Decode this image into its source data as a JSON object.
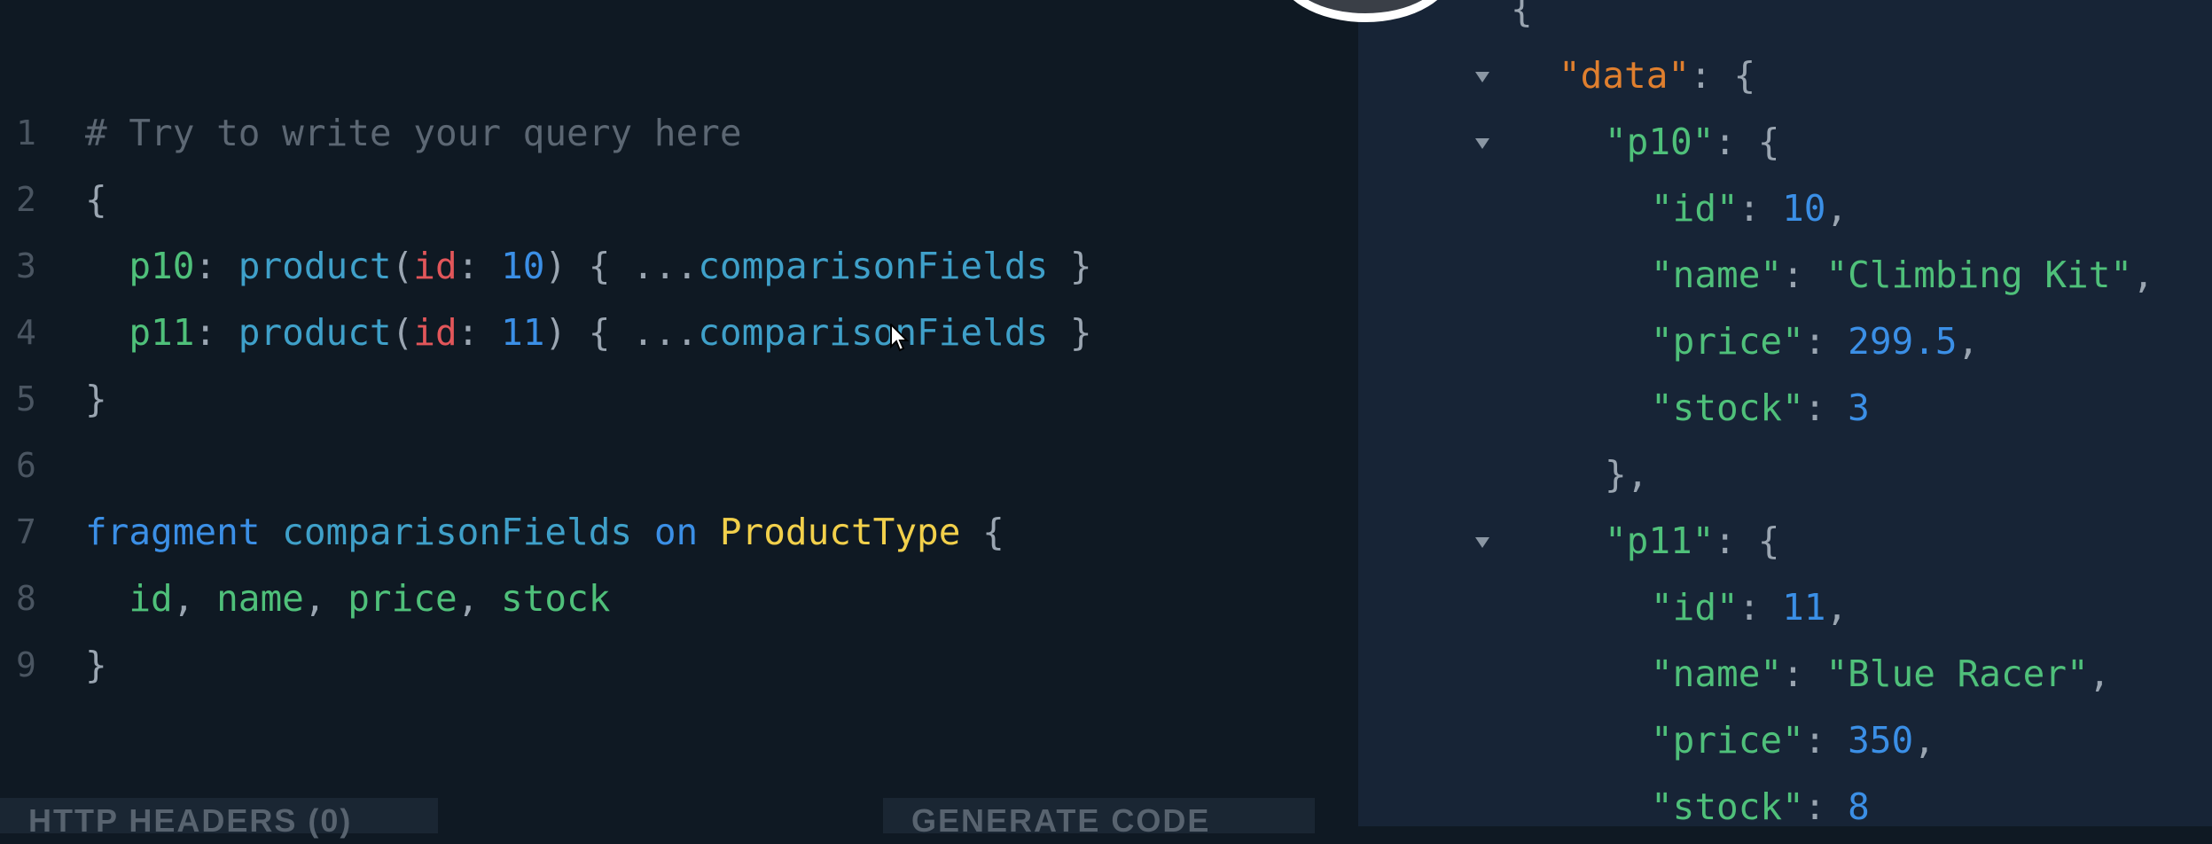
{
  "editor": {
    "lines": [
      {
        "n": "1",
        "tokens": [
          {
            "t": "# Try to write your query here",
            "c": "c-comment"
          }
        ]
      },
      {
        "n": "2",
        "tokens": [
          {
            "t": "{",
            "c": "c-punct"
          }
        ]
      },
      {
        "n": "3",
        "tokens": [
          {
            "t": "  p10",
            "c": "c-alias"
          },
          {
            "t": ": ",
            "c": "c-punct"
          },
          {
            "t": "product",
            "c": "c-func"
          },
          {
            "t": "(",
            "c": "c-punct"
          },
          {
            "t": "id",
            "c": "c-arg"
          },
          {
            "t": ": ",
            "c": "c-punct"
          },
          {
            "t": "10",
            "c": "c-num"
          },
          {
            "t": ") { ...",
            "c": "c-punct"
          },
          {
            "t": "comparisonFields",
            "c": "c-frag"
          },
          {
            "t": " }",
            "c": "c-punct"
          }
        ]
      },
      {
        "n": "4",
        "tokens": [
          {
            "t": "  p11",
            "c": "c-alias"
          },
          {
            "t": ": ",
            "c": "c-punct"
          },
          {
            "t": "product",
            "c": "c-func"
          },
          {
            "t": "(",
            "c": "c-punct"
          },
          {
            "t": "id",
            "c": "c-arg"
          },
          {
            "t": ": ",
            "c": "c-punct"
          },
          {
            "t": "11",
            "c": "c-num"
          },
          {
            "t": ") { ...",
            "c": "c-punct"
          },
          {
            "t": "comparisonFields",
            "c": "c-frag"
          },
          {
            "t": " }",
            "c": "c-punct"
          }
        ]
      },
      {
        "n": "5",
        "tokens": [
          {
            "t": "}",
            "c": "c-punct"
          }
        ]
      },
      {
        "n": "6",
        "tokens": []
      },
      {
        "n": "7",
        "tokens": [
          {
            "t": "fragment",
            "c": "c-kw"
          },
          {
            "t": " ",
            "c": "c-punct"
          },
          {
            "t": "comparisonFields",
            "c": "c-frag"
          },
          {
            "t": " ",
            "c": "c-punct"
          },
          {
            "t": "on",
            "c": "c-kw"
          },
          {
            "t": " ",
            "c": "c-punct"
          },
          {
            "t": "ProductType",
            "c": "c-type"
          },
          {
            "t": " {",
            "c": "c-punct"
          }
        ]
      },
      {
        "n": "8",
        "tokens": [
          {
            "t": "  id",
            "c": "c-field"
          },
          {
            "t": ", ",
            "c": "c-punct"
          },
          {
            "t": "name",
            "c": "c-field"
          },
          {
            "t": ", ",
            "c": "c-punct"
          },
          {
            "t": "price",
            "c": "c-field"
          },
          {
            "t": ", ",
            "c": "c-punct"
          },
          {
            "t": "stock",
            "c": "c-field"
          }
        ]
      },
      {
        "n": "9",
        "tokens": [
          {
            "t": "}",
            "c": "c-punct"
          }
        ]
      }
    ]
  },
  "bottom_bar": {
    "headers_label": "HTTP HEADERS (0)",
    "generate_label": "GENERATE CODE"
  },
  "results": {
    "lines": [
      {
        "arrow": false,
        "indent": 0,
        "tokens": [
          {
            "t": "{",
            "c": "r-punct"
          }
        ]
      },
      {
        "arrow": true,
        "indent": 1,
        "tokens": [
          {
            "t": "\"data\"",
            "c": "r-key-orange"
          },
          {
            "t": ": {",
            "c": "r-punct"
          }
        ]
      },
      {
        "arrow": true,
        "indent": 2,
        "tokens": [
          {
            "t": "\"p10\"",
            "c": "r-key"
          },
          {
            "t": ": {",
            "c": "r-punct"
          }
        ]
      },
      {
        "arrow": false,
        "indent": 3,
        "tokens": [
          {
            "t": "\"id\"",
            "c": "r-key"
          },
          {
            "t": ": ",
            "c": "r-punct"
          },
          {
            "t": "10",
            "c": "r-num"
          },
          {
            "t": ",",
            "c": "r-punct"
          }
        ]
      },
      {
        "arrow": false,
        "indent": 3,
        "tokens": [
          {
            "t": "\"name\"",
            "c": "r-key"
          },
          {
            "t": ": ",
            "c": "r-punct"
          },
          {
            "t": "\"Climbing Kit\"",
            "c": "r-str"
          },
          {
            "t": ",",
            "c": "r-punct"
          }
        ]
      },
      {
        "arrow": false,
        "indent": 3,
        "tokens": [
          {
            "t": "\"price\"",
            "c": "r-key"
          },
          {
            "t": ": ",
            "c": "r-punct"
          },
          {
            "t": "299.5",
            "c": "r-num"
          },
          {
            "t": ",",
            "c": "r-punct"
          }
        ]
      },
      {
        "arrow": false,
        "indent": 3,
        "tokens": [
          {
            "t": "\"stock\"",
            "c": "r-key"
          },
          {
            "t": ": ",
            "c": "r-punct"
          },
          {
            "t": "3",
            "c": "r-num"
          }
        ]
      },
      {
        "arrow": false,
        "indent": 2,
        "tokens": [
          {
            "t": "},",
            "c": "r-punct"
          }
        ]
      },
      {
        "arrow": true,
        "indent": 2,
        "tokens": [
          {
            "t": "\"p11\"",
            "c": "r-key"
          },
          {
            "t": ": {",
            "c": "r-punct"
          }
        ]
      },
      {
        "arrow": false,
        "indent": 3,
        "tokens": [
          {
            "t": "\"id\"",
            "c": "r-key"
          },
          {
            "t": ": ",
            "c": "r-punct"
          },
          {
            "t": "11",
            "c": "r-num"
          },
          {
            "t": ",",
            "c": "r-punct"
          }
        ]
      },
      {
        "arrow": false,
        "indent": 3,
        "tokens": [
          {
            "t": "\"name\"",
            "c": "r-key"
          },
          {
            "t": ": ",
            "c": "r-punct"
          },
          {
            "t": "\"Blue Racer\"",
            "c": "r-str"
          },
          {
            "t": ",",
            "c": "r-punct"
          }
        ]
      },
      {
        "arrow": false,
        "indent": 3,
        "tokens": [
          {
            "t": "\"price\"",
            "c": "r-key"
          },
          {
            "t": ": ",
            "c": "r-punct"
          },
          {
            "t": "350",
            "c": "r-num"
          },
          {
            "t": ",",
            "c": "r-punct"
          }
        ]
      },
      {
        "arrow": false,
        "indent": 3,
        "tokens": [
          {
            "t": "\"stock\"",
            "c": "r-key"
          },
          {
            "t": ": ",
            "c": "r-punct"
          },
          {
            "t": "8",
            "c": "r-num"
          }
        ]
      }
    ]
  },
  "icons": {
    "cursor": "mouse-pointer-icon"
  }
}
